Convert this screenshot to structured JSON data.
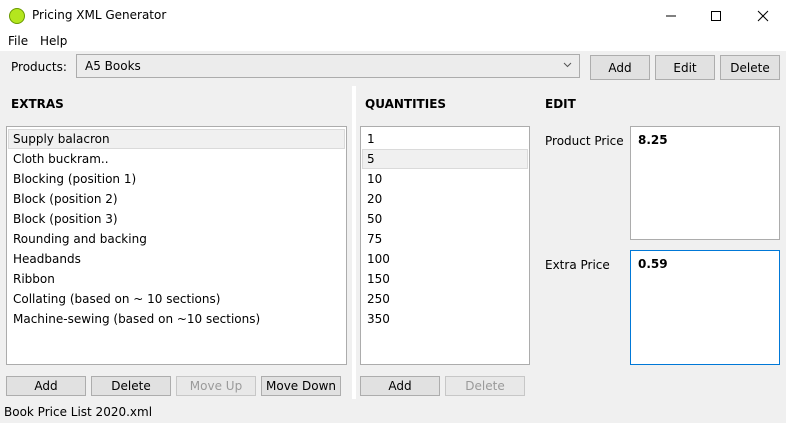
{
  "window": {
    "title": "Pricing XML Generator",
    "minimize": "—",
    "maximize": "☐",
    "close": "✕"
  },
  "menu": [
    "File",
    "Help"
  ],
  "products": {
    "label": "Products:",
    "selected": "A5 Books",
    "buttons": [
      "Add",
      "Edit",
      "Delete"
    ]
  },
  "extras": {
    "header": "EXTRAS",
    "items": [
      "Supply balacron",
      "Cloth buckram..",
      "Blocking (position 1)",
      "Block (position 2)",
      "Block (position 3)",
      "Rounding and backing",
      "Headbands",
      "Ribbon",
      "Collating (based on ~ 10 sections)",
      "Machine-sewing (based on ~10 sections)"
    ],
    "selected_index": 0,
    "buttons": [
      "Add",
      "Delete",
      "Move Up",
      "Move Down"
    ]
  },
  "quantities": {
    "header": "QUANTITIES",
    "items": [
      "1",
      "5",
      "10",
      "20",
      "50",
      "75",
      "100",
      "150",
      "250",
      "350"
    ],
    "selected_index": 1,
    "buttons": [
      "Add",
      "Delete"
    ]
  },
  "edit": {
    "header": "EDIT",
    "product_price_label": "Product Price",
    "product_price": "8.25",
    "extra_price_label": "Extra Price",
    "extra_price": "0.59"
  },
  "status": {
    "file": "Book Price List 2020.xml"
  }
}
